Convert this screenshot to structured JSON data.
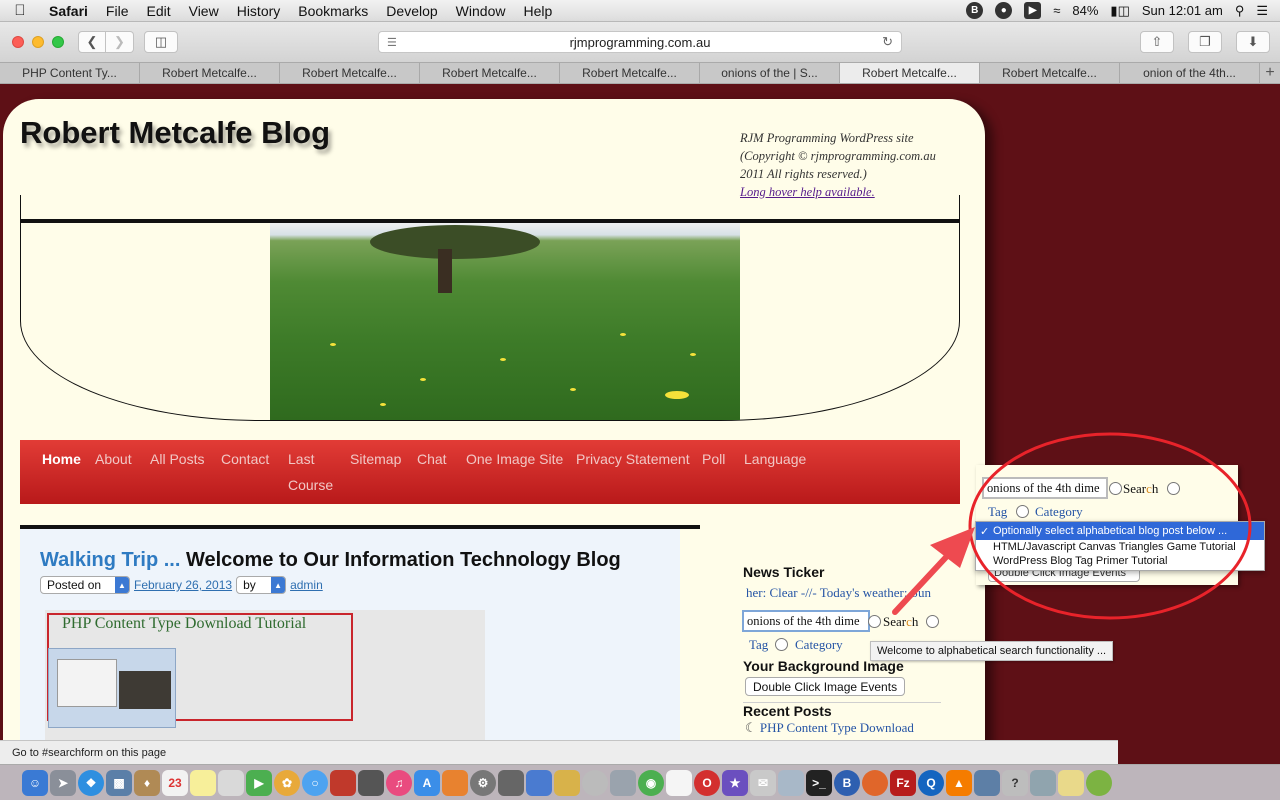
{
  "menubar": {
    "app_name": "Safari",
    "menus": [
      "File",
      "Edit",
      "View",
      "History",
      "Bookmarks",
      "Develop",
      "Window",
      "Help"
    ],
    "battery": "84%",
    "clock": "Sun 12:01 am"
  },
  "toolbar": {
    "url": "rjmprogramming.com.au"
  },
  "tabs": [
    {
      "label": "PHP Content Ty..."
    },
    {
      "label": "Robert Metcalfe..."
    },
    {
      "label": "Robert Metcalfe..."
    },
    {
      "label": "Robert Metcalfe..."
    },
    {
      "label": "Robert Metcalfe..."
    },
    {
      "label": "onions of the | S..."
    },
    {
      "label": "Robert Metcalfe..."
    },
    {
      "label": "Robert Metcalfe..."
    },
    {
      "label": "onion of the 4th..."
    }
  ],
  "site": {
    "title": "Robert Metcalfe Blog",
    "meta_line1": "RJM Programming WordPress site",
    "meta_line2": "(Copyright © rjmprogramming.com.au",
    "meta_line3": "2011 All rights reserved.)",
    "help_link": "Long hover help available."
  },
  "nav": {
    "home": "Home",
    "about": "About",
    "all_posts": "All Posts",
    "contact": "Contact",
    "last": "Last",
    "course": "Course",
    "sitemap": "Sitemap",
    "chat": "Chat",
    "one_image": "One Image Site",
    "privacy": "Privacy Statement",
    "poll": "Poll",
    "language": "Language"
  },
  "post": {
    "title_lead": "Walking Trip ...",
    "title_main": "Welcome to Our Information Technology Blog",
    "posted_on": "Posted on",
    "date": "February 26, 2013",
    "by": "by",
    "author": "admin",
    "teaser_title": "PHP Content Type Download Tutorial"
  },
  "sidebar": {
    "news_ticker_heading": "News Ticker",
    "ticker_text": "her: Clear -//- Today's weather: Sun",
    "search_value": "onions of the 4th dime",
    "search_label_pre": "Sear",
    "search_label_post": "h",
    "search_label_c": "c",
    "tag_label": "Tag",
    "category_label": "Category",
    "background_heading": "Your Background Image",
    "background_button": "Double Click Image Events",
    "recent_heading": "Recent Posts",
    "recent_first": "PHP Content Type Download",
    "tooltip": "Welcome to alphabetical search functionality ..."
  },
  "inset": {
    "search_value": "onions of the 4th dime",
    "search_label_pre": "Sear",
    "search_label_c": "c",
    "search_label_post": "h",
    "tag_label": "Tag",
    "category_label": "Category",
    "dropdown_selected": "Optionally select alphabetical blog post below ...",
    "dropdown_options": [
      "HTML/Javascript Canvas Triangles Game Tutorial",
      "WordPress Blog Tag Primer Tutorial"
    ],
    "behind_button": "Double Click Image Events"
  },
  "statusbar": {
    "text": "Go to #searchform on this page"
  },
  "colors": {
    "page_bg": "#5e1016",
    "nav_red": "#d12b27",
    "annotation_red": "#e8232a",
    "link_blue": "#2554a5"
  }
}
